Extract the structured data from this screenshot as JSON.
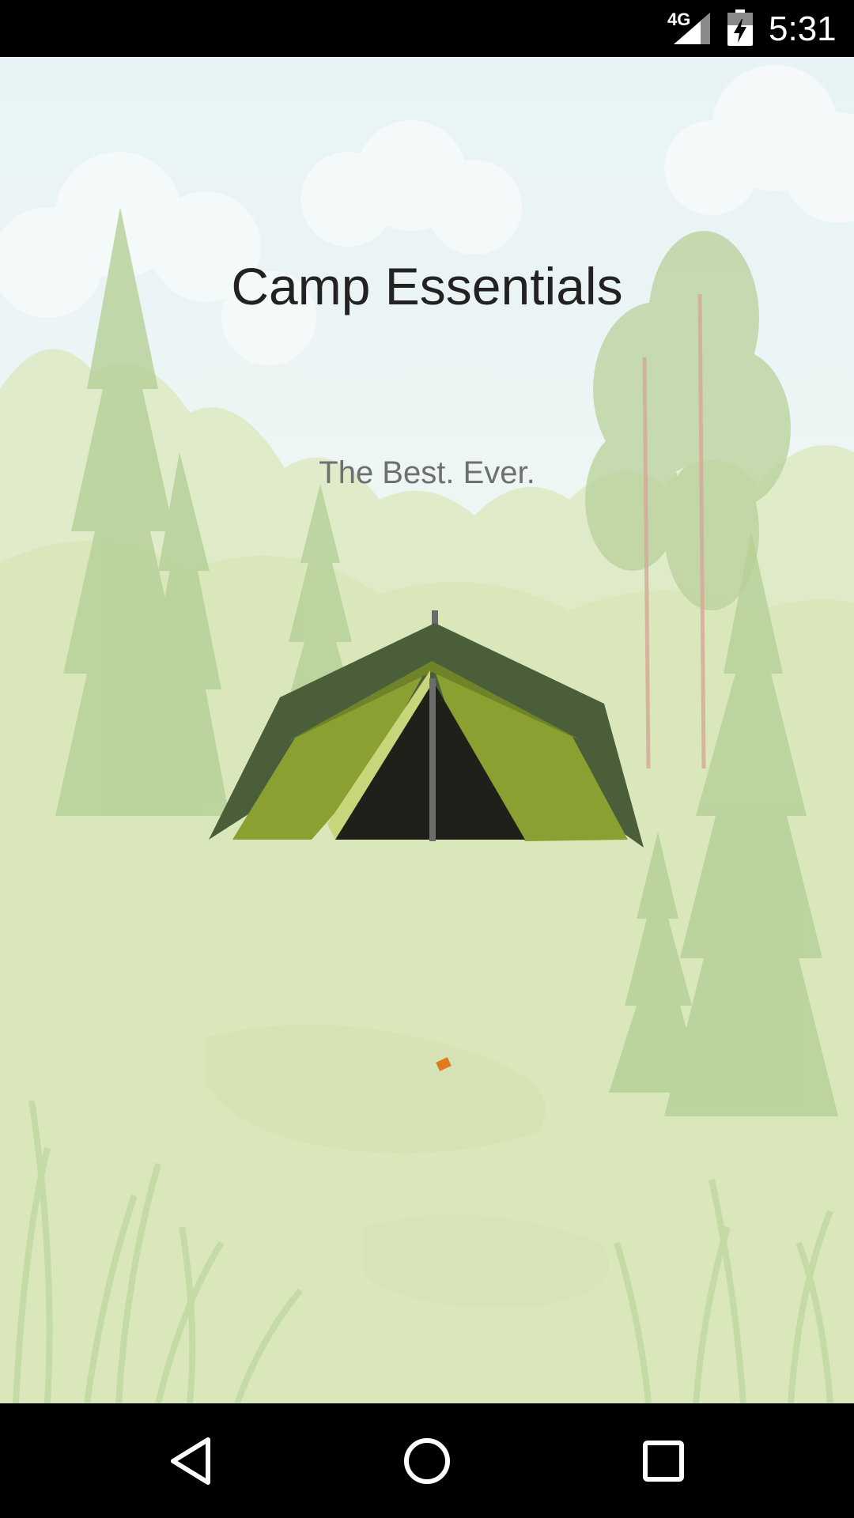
{
  "status_bar": {
    "network_type": "4G",
    "time": "5:31",
    "icons": [
      "signal-icon",
      "battery-charging-icon"
    ]
  },
  "app": {
    "title": "Camp Essentials",
    "subtitle": "The Best. Ever."
  },
  "nav_bar": {
    "icons": [
      "back-icon",
      "home-icon",
      "recents-icon"
    ]
  },
  "colors": {
    "sky": "#eef6f8",
    "meadow": "#dfeac2",
    "tent_roof": "#4a5e3a",
    "tent_body": "#8aa030",
    "tent_door": "#20201a",
    "loading_dot": "#e07a1f"
  }
}
